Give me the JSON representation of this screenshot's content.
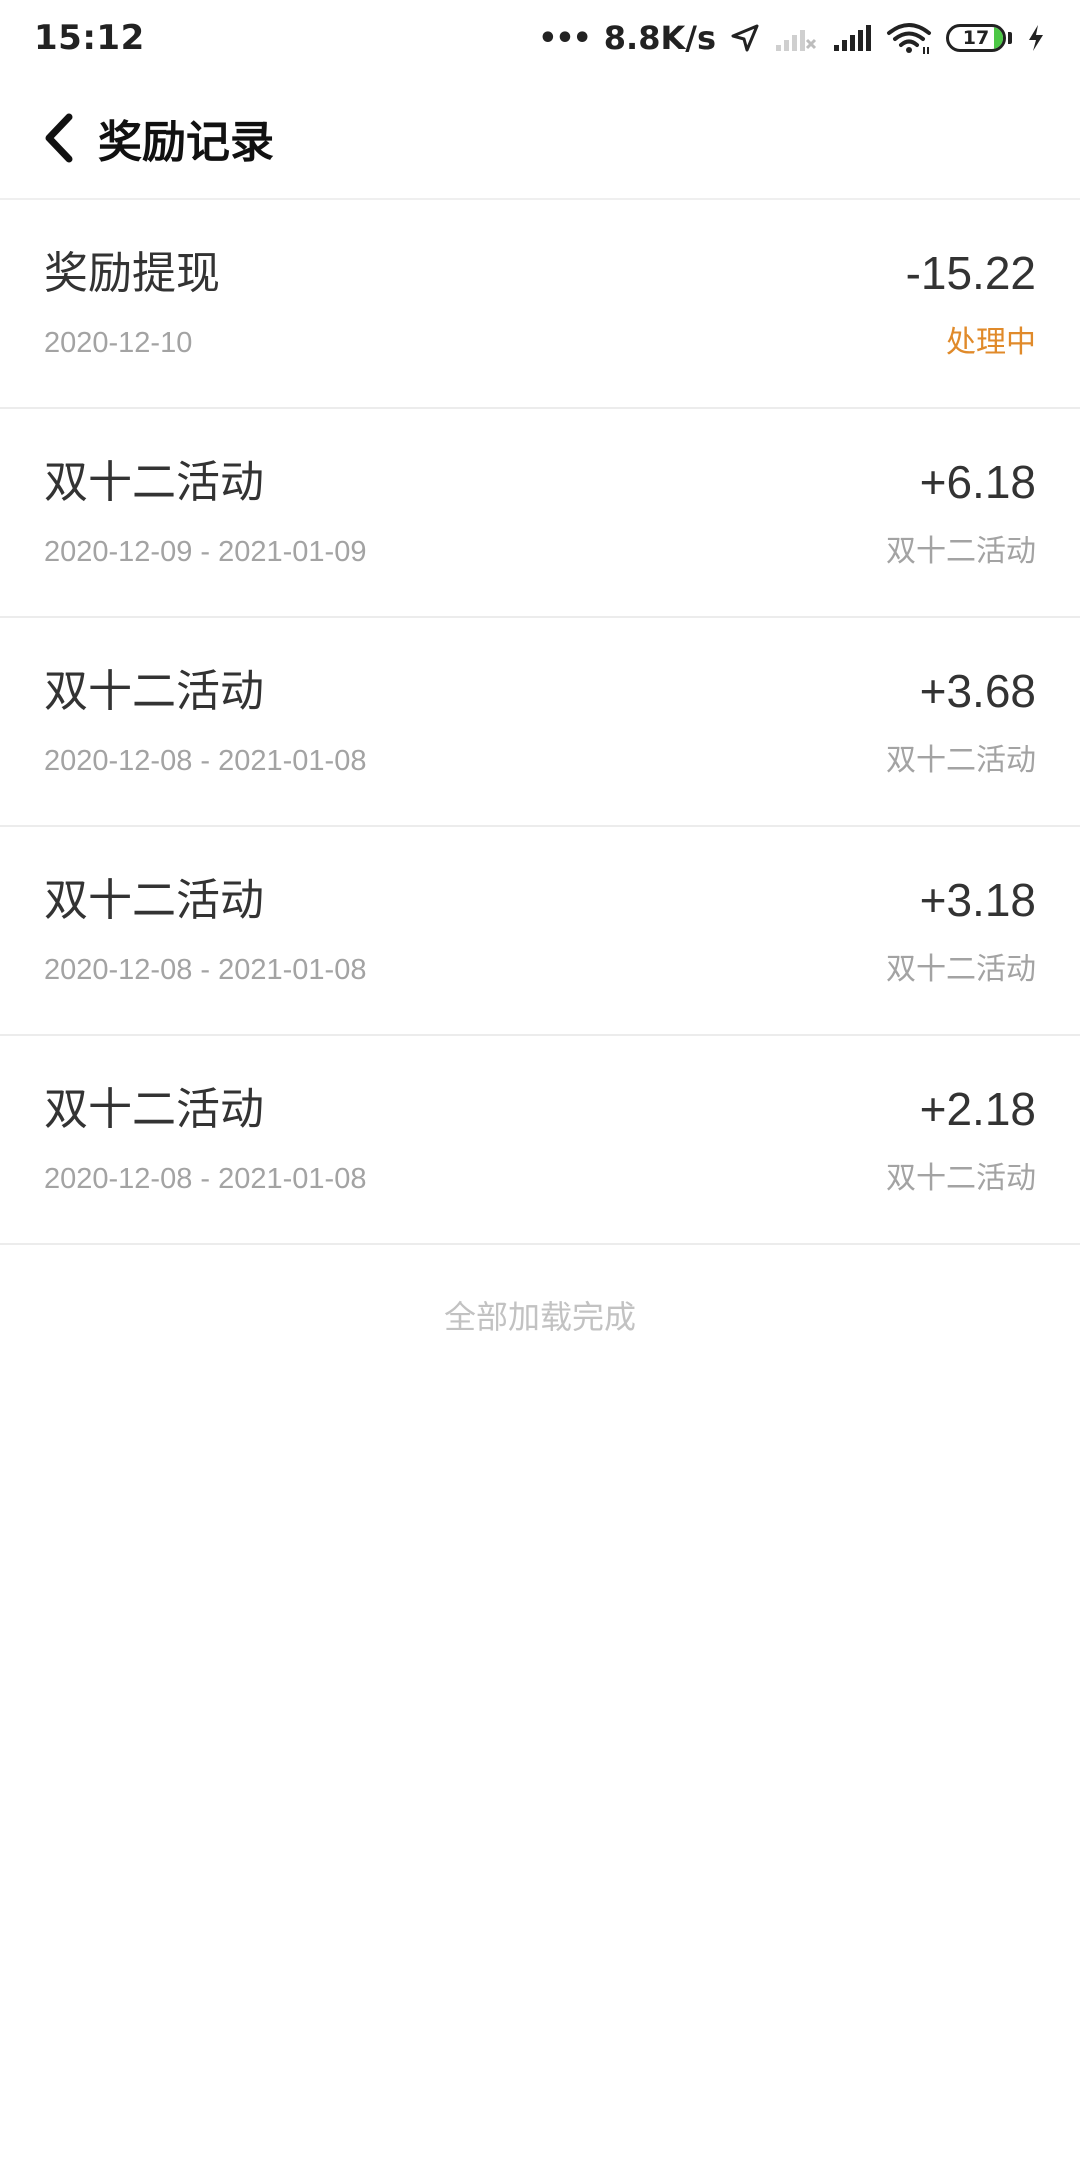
{
  "status_bar": {
    "time": "15:12",
    "dots": "•••",
    "network_speed": "8.8K/s",
    "battery_level": "17",
    "battery_fraction": 0.17,
    "battery_color": "#4cc745",
    "icons": [
      "location-arrow-icon",
      "no-signal-icon",
      "signal-icon",
      "wifi-icon",
      "battery-icon",
      "charging-icon"
    ]
  },
  "header": {
    "back_icon": "chevron-left-icon",
    "title": "奖励记录"
  },
  "records": [
    {
      "title": "奖励提现",
      "amount": "-15.22",
      "date": "2020-12-10",
      "status": "处理中",
      "status_color": "#e08a2a"
    },
    {
      "title": "双十二活动",
      "amount": "+6.18",
      "date": "2020-12-09 - 2021-01-09",
      "status": "双十二活动"
    },
    {
      "title": "双十二活动",
      "amount": "+3.68",
      "date": "2020-12-08 - 2021-01-08",
      "status": "双十二活动"
    },
    {
      "title": "双十二活动",
      "amount": "+3.18",
      "date": "2020-12-08 - 2021-01-08",
      "status": "双十二活动"
    },
    {
      "title": "双十二活动",
      "amount": "+2.18",
      "date": "2020-12-08 - 2021-01-08",
      "status": "双十二活动"
    }
  ],
  "footer": {
    "load_complete_text": "全部加载完成"
  }
}
